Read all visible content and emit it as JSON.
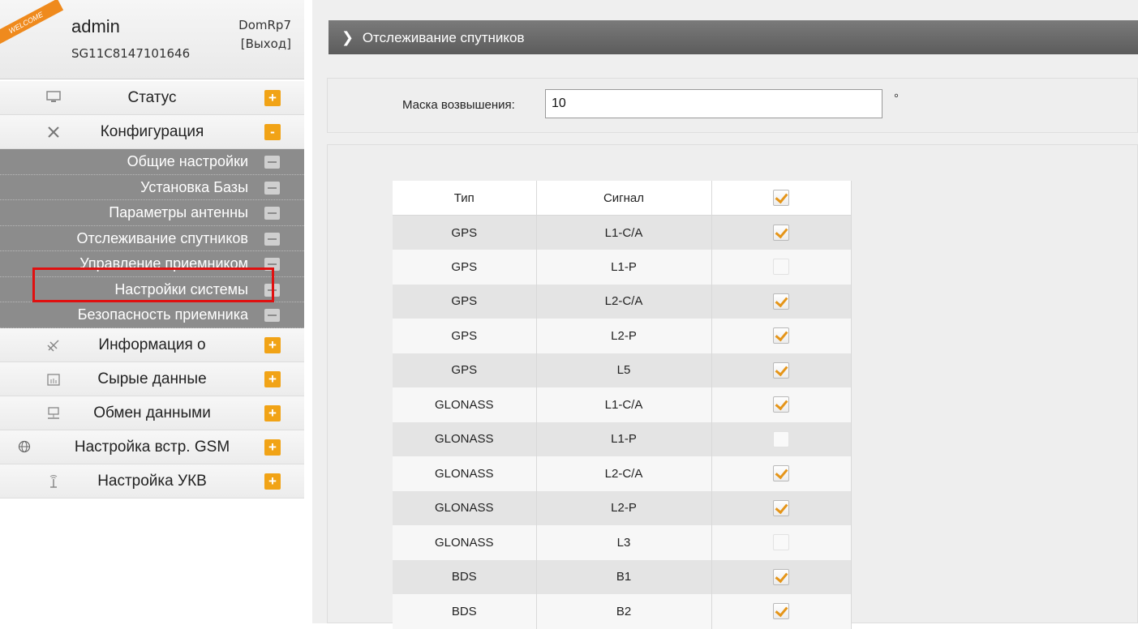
{
  "user": {
    "welcome": "WELCOME",
    "name": "admin",
    "serial": "SG11C8147101646",
    "device": "DomRp7",
    "logout": "[Выход]"
  },
  "menu": {
    "items_top": [
      {
        "label": "Статус",
        "icon": "monitor-icon",
        "toggle": "+"
      },
      {
        "label": "Конфигурация",
        "icon": "tools-icon",
        "toggle": "-"
      }
    ],
    "submenu": [
      {
        "label": "Общие настройки"
      },
      {
        "label": "Установка Базы"
      },
      {
        "label": "Параметры антенны"
      },
      {
        "label": "Отслеживание спутников"
      },
      {
        "label": "Управление приемником"
      },
      {
        "label": "Настройки системы"
      },
      {
        "label": "Безопасность приемника"
      }
    ],
    "items_bottom": [
      {
        "label": "Информация о",
        "icon": "satellite-icon",
        "toggle": "+"
      },
      {
        "label": "Сырые данные",
        "icon": "calendar-data-icon",
        "toggle": "+"
      },
      {
        "label": "Обмен данными",
        "icon": "network-icon",
        "toggle": "+"
      },
      {
        "label": "Настройка встр. GSM",
        "icon": "globe-icon",
        "toggle": "+"
      },
      {
        "label": "Настройка УКВ",
        "icon": "antenna-icon",
        "toggle": "+"
      }
    ]
  },
  "page": {
    "title": "Отслеживание спутников",
    "mask_label": "Маска возвышения:",
    "mask_value": "10",
    "mask_unit": "°"
  },
  "table": {
    "headers": [
      "Тип",
      "Сигнал"
    ],
    "header_checked": true,
    "rows": [
      {
        "type": "GPS",
        "signal": "L1-C/A",
        "checked": true
      },
      {
        "type": "GPS",
        "signal": "L1-P",
        "checked": false
      },
      {
        "type": "GPS",
        "signal": "L2-C/A",
        "checked": true
      },
      {
        "type": "GPS",
        "signal": "L2-P",
        "checked": true
      },
      {
        "type": "GPS",
        "signal": "L5",
        "checked": true
      },
      {
        "type": "GLONASS",
        "signal": "L1-C/A",
        "checked": true
      },
      {
        "type": "GLONASS",
        "signal": "L1-P",
        "checked": false
      },
      {
        "type": "GLONASS",
        "signal": "L2-C/A",
        "checked": true
      },
      {
        "type": "GLONASS",
        "signal": "L2-P",
        "checked": true
      },
      {
        "type": "GLONASS",
        "signal": "L3",
        "checked": false
      },
      {
        "type": "BDS",
        "signal": "B1",
        "checked": true
      },
      {
        "type": "BDS",
        "signal": "B2",
        "checked": true
      }
    ]
  },
  "colors": {
    "accent": "#f1a316",
    "submenu_bg": "#8c8c8c",
    "header_bg": "#666666",
    "highlight": "#e01010"
  }
}
